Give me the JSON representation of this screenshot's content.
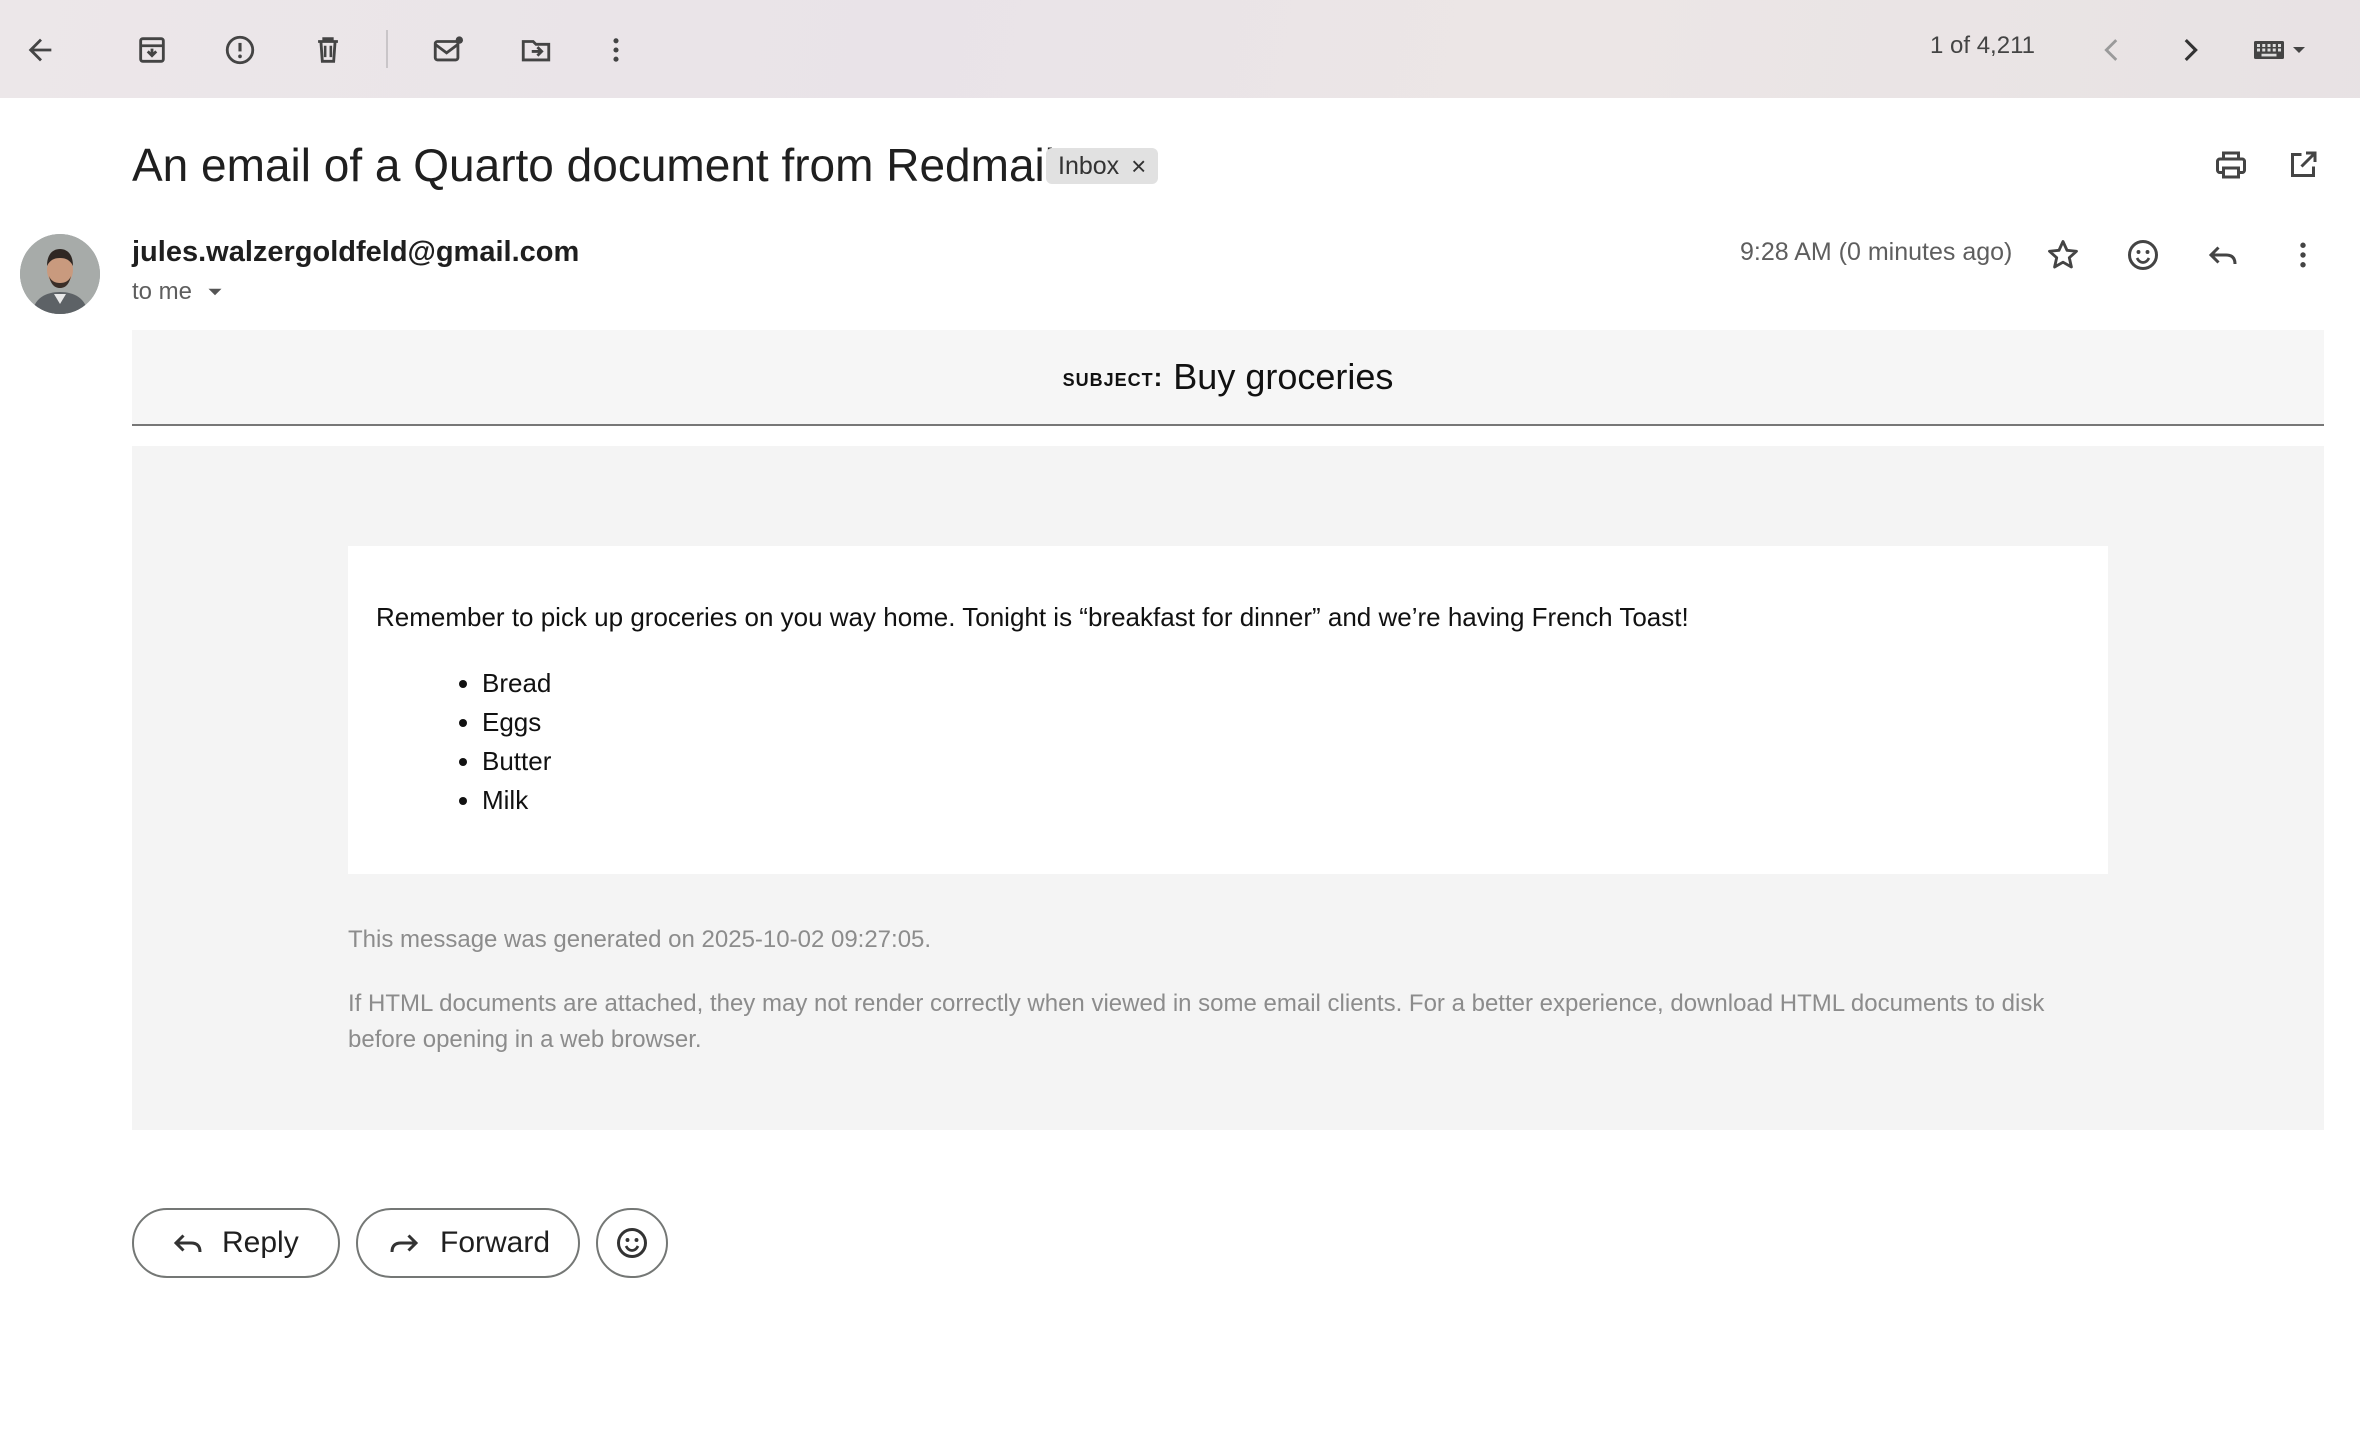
{
  "toolbar": {
    "back": "arrow-left-icon",
    "archive": "archive-icon",
    "spam": "report-spam-icon",
    "delete": "trash-icon",
    "mark_unread": "mark-unread-icon",
    "move": "move-to-icon",
    "more": "more-vert-icon",
    "pager": "1 of 4,211",
    "input_tools": "keyboard-icon"
  },
  "email": {
    "title": "An email of a Quarto document from Redmail",
    "label": "Inbox",
    "label_remove": "×",
    "sender": "jules.walzergoldfeld@gmail.com",
    "to": "to me",
    "time": "9:28 AM (0 minutes ago)",
    "subject_label": "subject:",
    "subject": "Buy groceries",
    "body_text": "Remember to pick up groceries on you way home. Tonight is “breakfast for dinner” and we’re having French Toast!",
    "items": [
      "Bread",
      "Eggs",
      "Butter",
      "Milk"
    ],
    "footer_generated": "This message was generated on 2025-10-02 09:27:05.",
    "footer_note": "If HTML documents are attached, they may not render correctly when viewed in some email clients. For a better experience, download HTML documents to disk before opening in a web browser."
  },
  "actions": {
    "reply": "Reply",
    "forward": "Forward"
  },
  "colors": {
    "panel": "#ffffff",
    "body_bg": "#f4f4f4",
    "muted_text": "#8c8c8c"
  }
}
